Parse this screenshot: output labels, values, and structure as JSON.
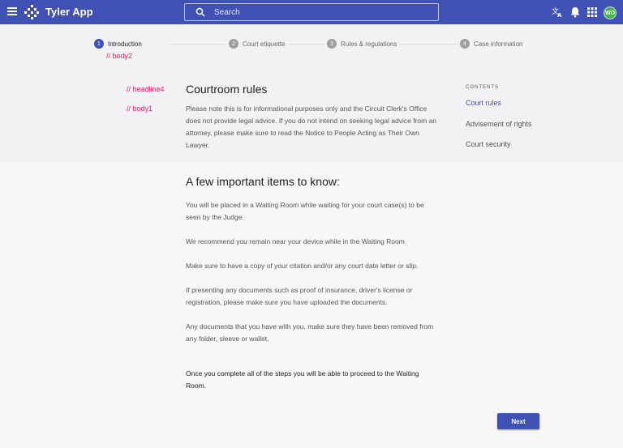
{
  "app": {
    "title": "Tyler App",
    "brand_color": "#3f51b5",
    "avatar_initials": "WO",
    "icons": [
      "menu-icon",
      "logo-icon",
      "search-icon",
      "translate-icon",
      "bell-icon",
      "apps-grid-icon"
    ]
  },
  "search": {
    "placeholder": "Search",
    "value": ""
  },
  "stepper": {
    "steps": [
      {
        "num": "1",
        "label": "Introduction",
        "active": true
      },
      {
        "num": "2",
        "label": "Court etiquette",
        "active": false
      },
      {
        "num": "3",
        "label": "Rules & regulations",
        "active": false
      },
      {
        "num": "4",
        "label": "Case information",
        "active": false
      }
    ]
  },
  "annotations": {
    "body2": "// body2",
    "headline4": "// headline4",
    "body1": "// body1"
  },
  "main": {
    "title": "Courtroom rules",
    "intro": "Please note this is for informational purposes only and the Circuit Clerk's Office does not provide legal advice. If you do not intend on seeking legal advice from an attorney, please make sure to read the Notice to People Acting as Their Own Lawyer.",
    "items_title": "A few important items to know:",
    "items": [
      "You will be placed in a Waiting Room while waiting for your court case(s) to be seen by the Judge.",
      "We recommend you remain near your device while in the Waiting Room.",
      "Make sure to have a copy of your citation and/or any court date letter or slip.",
      "If presenting any documents such as proof of insurance, driver's license or registration, please make sure you have uploaded the documents.",
      "Any documents that you have with you, make sure they have been removed from any folder, sleeve or wallet."
    ],
    "final_note": "Once you complete all of the steps you will be able to proceed to the Waiting Room."
  },
  "toc": {
    "heading": "CONTENTS",
    "items": [
      {
        "label": "Court rules",
        "active": true
      },
      {
        "label": "Advisement of rights",
        "active": false
      },
      {
        "label": "Court security",
        "active": false
      }
    ]
  },
  "footer": {
    "next_label": "Next"
  }
}
